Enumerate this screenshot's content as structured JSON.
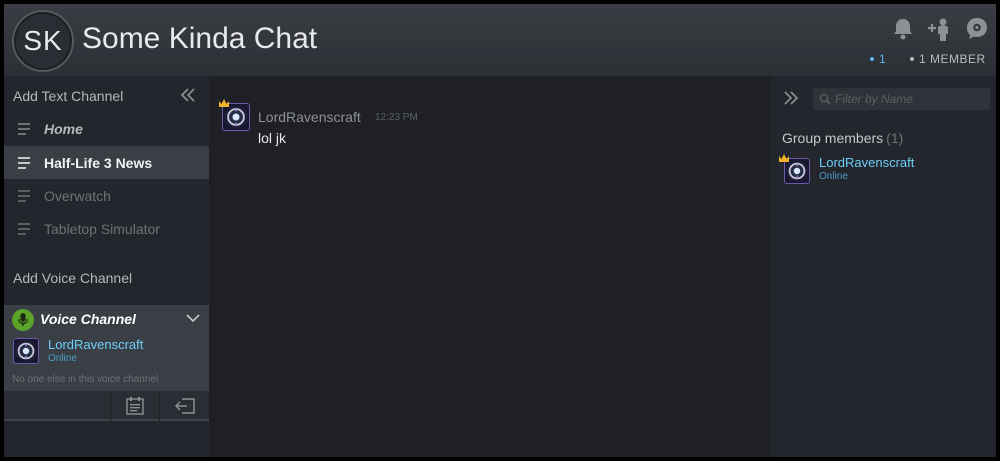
{
  "header": {
    "avatar_initials": "SK",
    "title": "Some Kinda Chat",
    "online_count": "1",
    "member_count": "1 MEMBER",
    "icons": [
      "bell-icon",
      "add-friend-icon",
      "settings-icon"
    ]
  },
  "sidebar": {
    "text_section_label": "Add Text Channel",
    "channels": [
      {
        "label": "Home",
        "state": "home"
      },
      {
        "label": "Half-Life 3 News",
        "state": "active"
      },
      {
        "label": "Overwatch",
        "state": "normal"
      },
      {
        "label": "Tabletop Simulator",
        "state": "normal"
      }
    ],
    "voice_section_label": "Add Voice Channel",
    "voice": {
      "title": "Voice Channel",
      "user_name": "LordRavenscraft",
      "user_status": "Online",
      "note": "No one else in this voice channel"
    }
  },
  "chat": {
    "messages": [
      {
        "author": "LordRavenscraft",
        "time": "12:23 PM",
        "text": "lol jk"
      }
    ]
  },
  "members": {
    "filter_placeholder": "Filter by Name",
    "heading": "Group members",
    "heading_count": "(1)",
    "list": [
      {
        "name": "LordRavenscraft",
        "status": "Online"
      }
    ]
  },
  "colors": {
    "accent_blue": "#6dcff6",
    "online_blue": "#5db6e8",
    "voice_green": "#5ba32b",
    "crown_gold": "#f0b428"
  }
}
